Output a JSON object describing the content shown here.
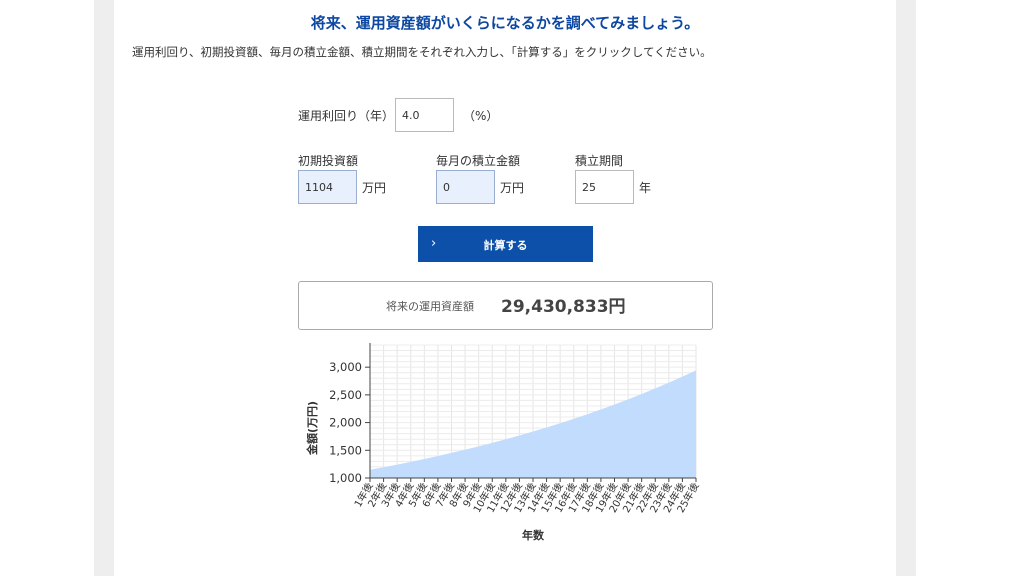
{
  "header": {
    "title": "将来、運用資産額がいくらになるかを調べてみましょう。",
    "instructions": "運用利回り、初期投資額、毎月の積立金額、積立期間をそれぞれ入力し、「計算する」をクリックしてください。"
  },
  "form": {
    "rate": {
      "label": "運用利回り（年）",
      "value": "4.0",
      "unit": "（%）"
    },
    "initial": {
      "label": "初期投資額",
      "value": "1104",
      "unit": "万円"
    },
    "monthly": {
      "label": "毎月の積立金額",
      "value": "0",
      "unit": "万円"
    },
    "period": {
      "label": "積立期間",
      "value": "25",
      "unit": "年"
    },
    "calc_button": {
      "label": "計算する",
      "icon": "chevron-right-icon"
    }
  },
  "result": {
    "label": "将来の運用資産額",
    "value": "29,430,833円"
  },
  "colors": {
    "title": "#0d47a1",
    "button": "#0d50a9",
    "input_highlight": "#e8effd",
    "area_fill": "#c2dcfd"
  },
  "chart_data": {
    "type": "area",
    "ylabel": "金額(万円)",
    "xlabel": "年数",
    "ylim": [
      1000,
      3400
    ],
    "yticks": [
      1000,
      1500,
      2000,
      2500,
      3000
    ],
    "ytick_labels": [
      "1,000",
      "1,500",
      "2,000",
      "2,500",
      "3,000"
    ],
    "grid": true,
    "categories": [
      "1年後",
      "2年後",
      "3年後",
      "4年後",
      "5年後",
      "6年後",
      "7年後",
      "8年後",
      "9年後",
      "10年後",
      "11年後",
      "12年後",
      "13年後",
      "14年後",
      "15年後",
      "16年後",
      "17年後",
      "18年後",
      "19年後",
      "20年後",
      "21年後",
      "22年後",
      "23年後",
      "24年後",
      "25年後"
    ],
    "series": [
      {
        "values": [
          1148,
          1194,
          1242,
          1292,
          1343,
          1397,
          1453,
          1511,
          1571,
          1634,
          1700,
          1768,
          1838,
          1912,
          1988,
          2068,
          2151,
          2237,
          2326,
          2419,
          2516,
          2617,
          2721,
          2830,
          2943
        ]
      }
    ]
  }
}
